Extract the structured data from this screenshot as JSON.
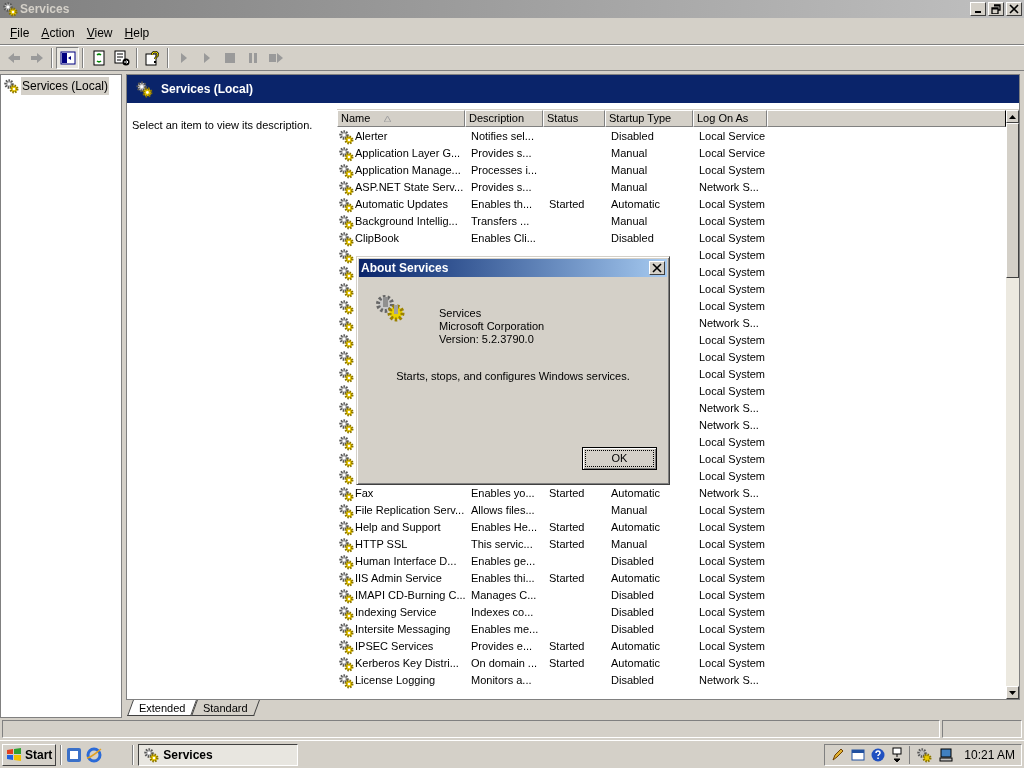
{
  "window": {
    "title": "Services"
  },
  "menu": [
    {
      "label": "File"
    },
    {
      "label": "Action"
    },
    {
      "label": "View"
    },
    {
      "label": "Help"
    }
  ],
  "toolbar": [
    {
      "kind": "back",
      "disabled": true
    },
    {
      "kind": "forward",
      "disabled": true
    },
    {
      "kind": "sep"
    },
    {
      "kind": "tree",
      "pressed": true
    },
    {
      "kind": "sep"
    },
    {
      "kind": "refresh"
    },
    {
      "kind": "export"
    },
    {
      "kind": "sep"
    },
    {
      "kind": "help"
    },
    {
      "kind": "sep"
    },
    {
      "kind": "play",
      "disabled": true
    },
    {
      "kind": "play",
      "disabled": true
    },
    {
      "kind": "stop",
      "disabled": true
    },
    {
      "kind": "pause",
      "disabled": true
    },
    {
      "kind": "restart",
      "disabled": true
    }
  ],
  "tree": [
    {
      "label": "Services (Local)",
      "selected": true
    }
  ],
  "pane_title": "Services (Local)",
  "description_hint": "Select an item to view its description.",
  "table": {
    "columns": [
      {
        "label": "Name",
        "sorted": true
      },
      {
        "label": "Description"
      },
      {
        "label": "Status"
      },
      {
        "label": "Startup Type"
      },
      {
        "label": "Log On As"
      }
    ],
    "rows": [
      {
        "name": "Alerter",
        "description": "Notifies sel...",
        "startup_type": "Disabled",
        "log_on_as": "Local Service"
      },
      {
        "name": "Application Layer G...",
        "description": "Provides s...",
        "startup_type": "Manual",
        "log_on_as": "Local Service"
      },
      {
        "name": "Application Manage...",
        "description": "Processes i...",
        "startup_type": "Manual",
        "log_on_as": "Local System"
      },
      {
        "name": "ASP.NET State Serv...",
        "description": "Provides s...",
        "startup_type": "Manual",
        "log_on_as": "Network S..."
      },
      {
        "name": "Automatic Updates",
        "description": "Enables th...",
        "status": "Started",
        "startup_type": "Automatic",
        "log_on_as": "Local System"
      },
      {
        "name": "Background Intellig...",
        "description": "Transfers ...",
        "startup_type": "Manual",
        "log_on_as": "Local System"
      },
      {
        "name": "ClipBook",
        "description": "Enables Cli...",
        "startup_type": "Disabled",
        "log_on_as": "Local System"
      },
      {
        "log_on_as": "Local System"
      },
      {
        "log_on_as": "Local System"
      },
      {
        "log_on_as": "Local System"
      },
      {
        "log_on_as": "Local System"
      },
      {
        "log_on_as": "Network S..."
      },
      {
        "log_on_as": "Local System"
      },
      {
        "log_on_as": "Local System"
      },
      {
        "log_on_as": "Local System"
      },
      {
        "log_on_as": "Local System"
      },
      {
        "log_on_as": "Network S..."
      },
      {
        "log_on_as": "Network S..."
      },
      {
        "log_on_as": "Local System"
      },
      {
        "log_on_as": "Local System"
      },
      {
        "log_on_as": "Local System"
      },
      {
        "name": "Fax",
        "description": "Enables yo...",
        "status": "Started",
        "startup_type": "Automatic",
        "log_on_as": "Network S..."
      },
      {
        "name": "File Replication Serv...",
        "description": "Allows files...",
        "startup_type": "Manual",
        "log_on_as": "Local System"
      },
      {
        "name": "Help and Support",
        "description": "Enables He...",
        "status": "Started",
        "startup_type": "Automatic",
        "log_on_as": "Local System"
      },
      {
        "name": "HTTP SSL",
        "description": "This servic...",
        "status": "Started",
        "startup_type": "Manual",
        "log_on_as": "Local System"
      },
      {
        "name": "Human Interface D...",
        "description": "Enables ge...",
        "startup_type": "Disabled",
        "log_on_as": "Local System"
      },
      {
        "name": "IIS Admin Service",
        "description": "Enables thi...",
        "status": "Started",
        "startup_type": "Automatic",
        "log_on_as": "Local System"
      },
      {
        "name": "IMAPI CD-Burning C...",
        "description": "Manages C...",
        "startup_type": "Disabled",
        "log_on_as": "Local System"
      },
      {
        "name": "Indexing Service",
        "description": "Indexes co...",
        "startup_type": "Disabled",
        "log_on_as": "Local System"
      },
      {
        "name": "Intersite Messaging",
        "description": "Enables me...",
        "startup_type": "Disabled",
        "log_on_as": "Local System"
      },
      {
        "name": "IPSEC Services",
        "description": "Provides e...",
        "status": "Started",
        "startup_type": "Automatic",
        "log_on_as": "Local System"
      },
      {
        "name": "Kerberos Key Distri...",
        "description": "On domain ...",
        "status": "Started",
        "startup_type": "Automatic",
        "log_on_as": "Local System"
      },
      {
        "name": "License Logging",
        "description": "Monitors a...",
        "startup_type": "Disabled",
        "log_on_as": "Network S..."
      }
    ]
  },
  "view_tabs": [
    {
      "label": "Extended",
      "selected": true
    },
    {
      "label": "Standard",
      "selected": false
    }
  ],
  "dialog": {
    "title": "About Services",
    "product": "Services",
    "company": "Microsoft Corporation",
    "version": "Version: 5.2.3790.0",
    "description": "Starts, stops, and configures Windows services.",
    "button": "OK"
  },
  "taskbar": {
    "start": "Start",
    "tasks": [
      {
        "label": "Services",
        "selected": true
      }
    ],
    "clock": "10:21 AM"
  }
}
